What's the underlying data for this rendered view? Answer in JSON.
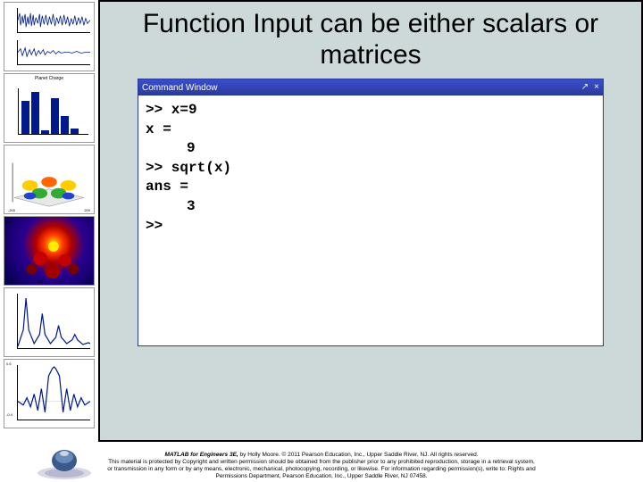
{
  "slide": {
    "title": "Function Input can be either scalars or matrices"
  },
  "sidebar": {
    "thumb2_title": "Planet Charge"
  },
  "command_window": {
    "title": "Command Window",
    "popout_glyph": "↗",
    "close_glyph": "×",
    "lines": {
      "l1": ">> x=9",
      "l2": "x =",
      "l3": "9",
      "l4": ">> sqrt(x)",
      "l5": "ans =",
      "l6": "3",
      "l7": ">>"
    }
  },
  "footer": {
    "book": "MATLAB for Engineers 3E,",
    "line1_rest": " by Holly Moore. © 2011 Pearson Education, Inc., Upper Saddle River, NJ.  All rights reserved.",
    "line2": "This material is protected by Copyright and written permission should be obtained from the publisher prior to any prohibited reproduction, storage in a retrieval system, or transmission in any form or by any means, electronic, mechanical, photocopying, recording, or likewise. For information regarding permission(s), write to: Rights and Permissions Department, Pearson Education, Inc., Upper Saddle River, NJ 07458."
  }
}
